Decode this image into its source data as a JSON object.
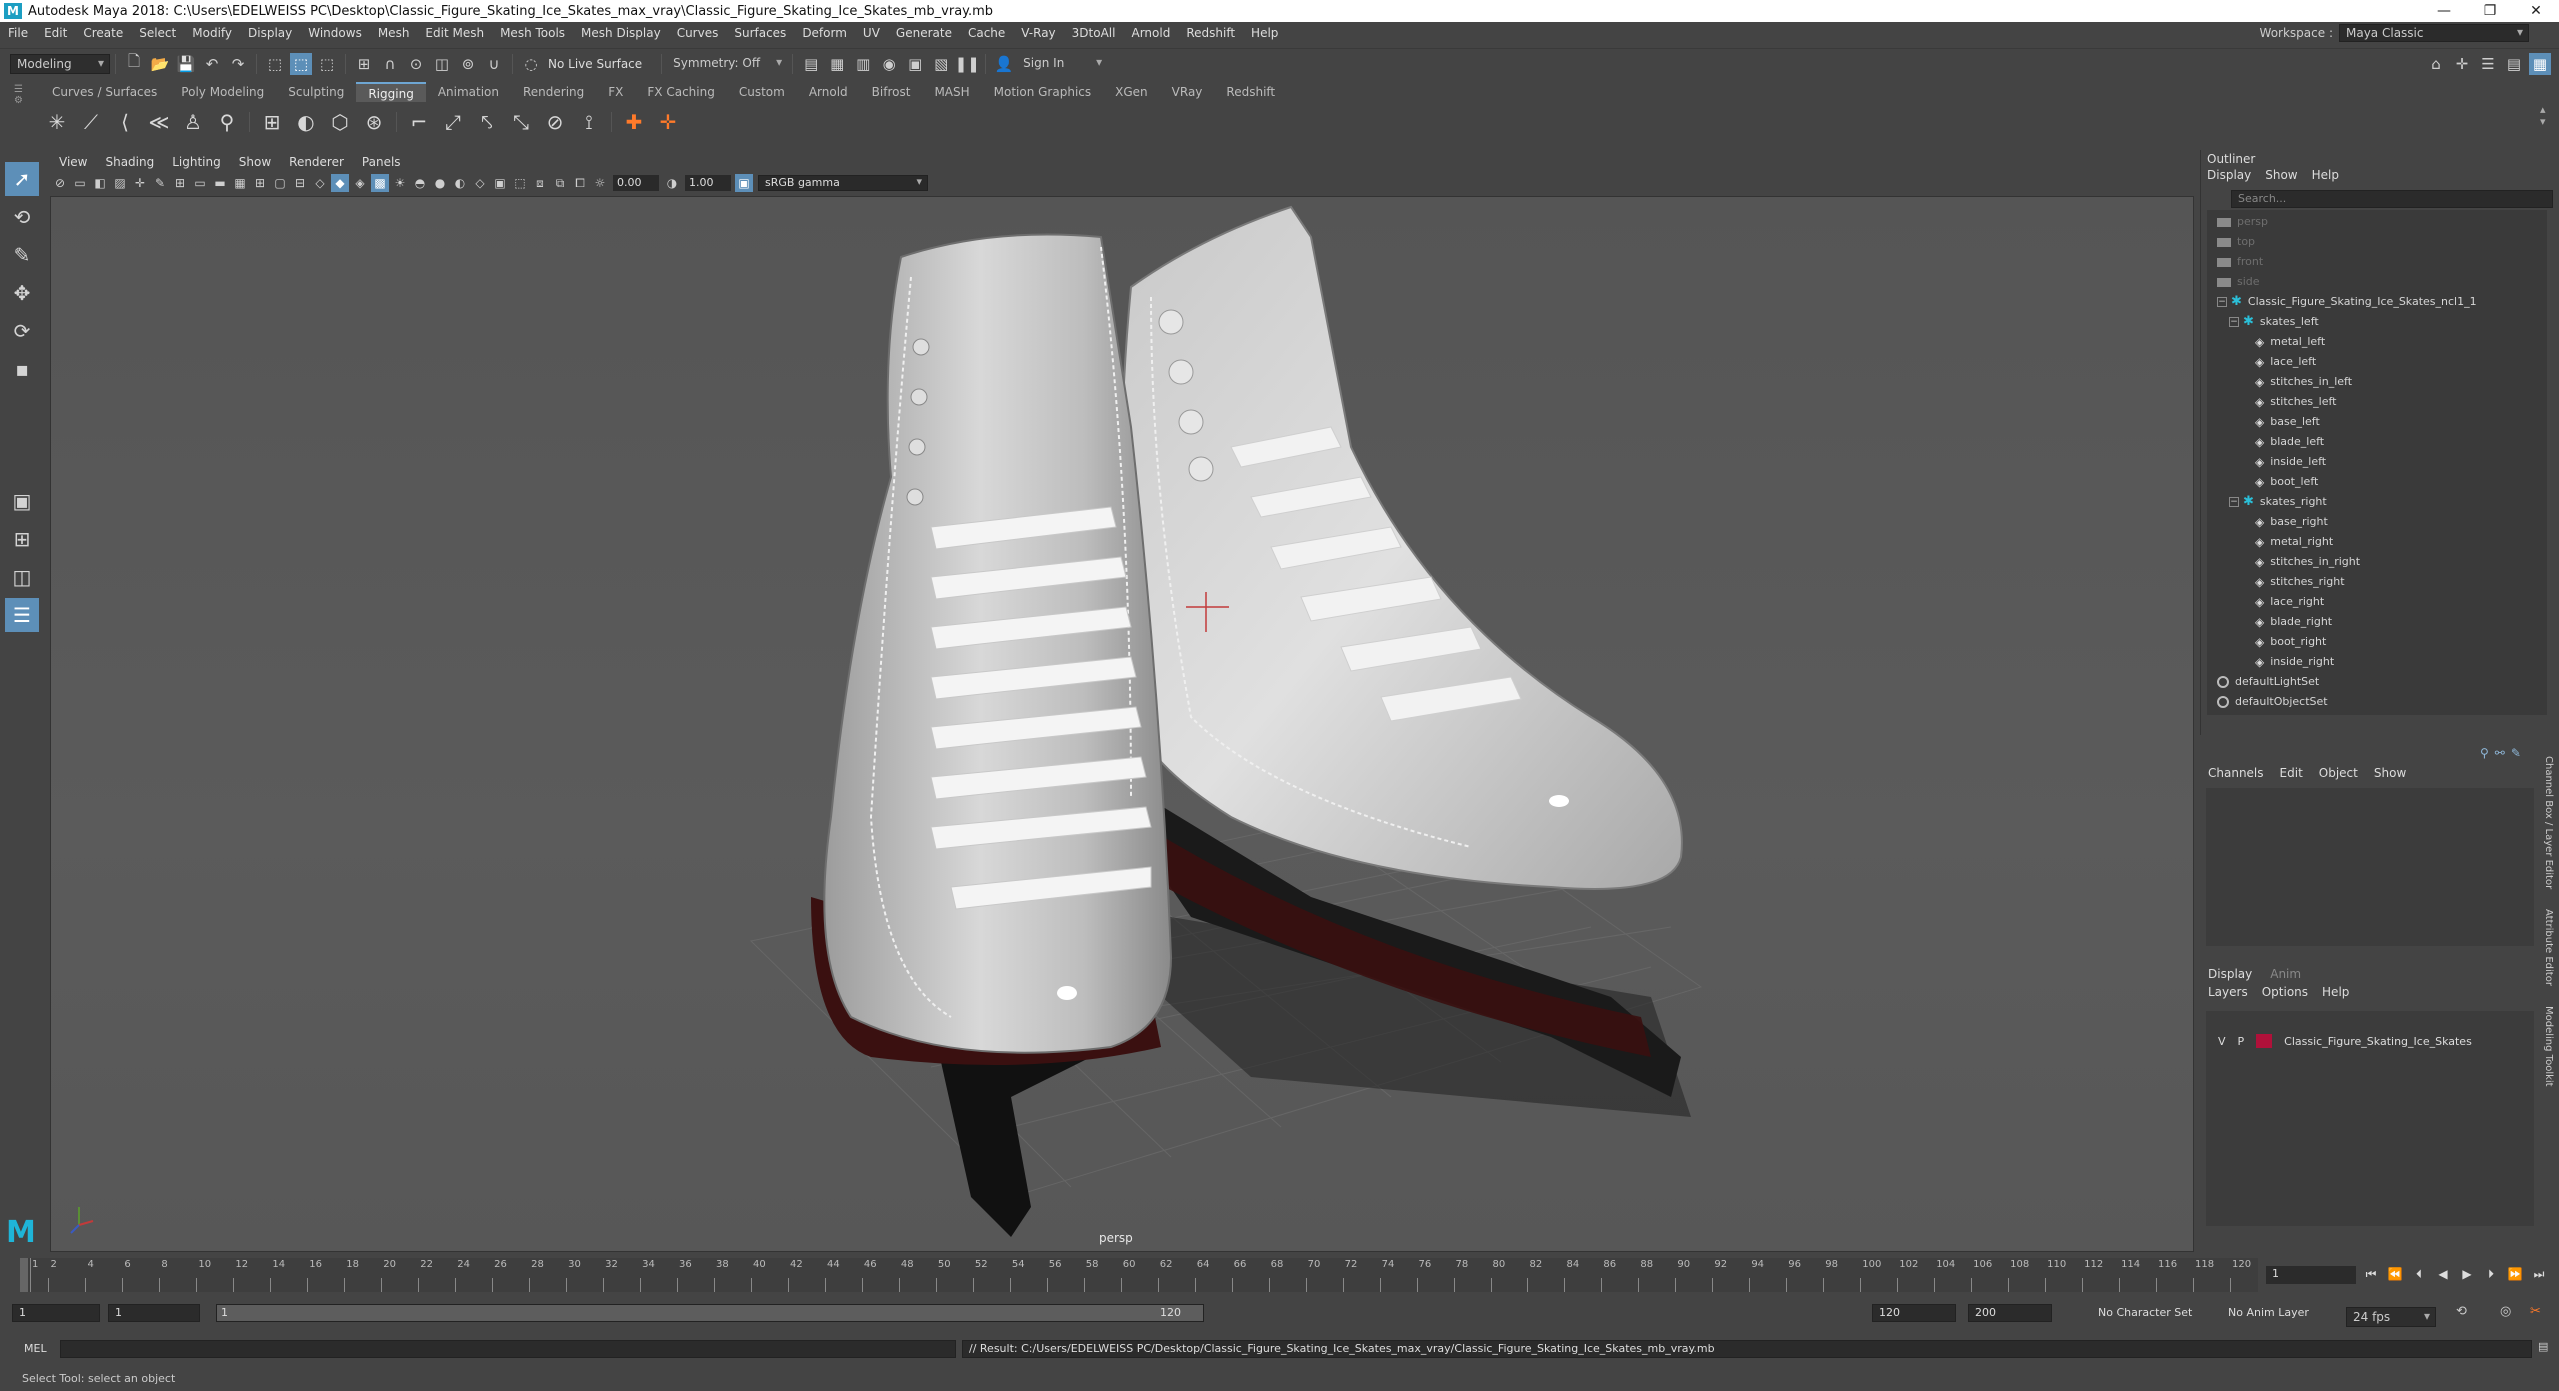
{
  "window": {
    "title": "Autodesk Maya 2018: C:\\Users\\EDELWEISS PC\\Desktop\\Classic_Figure_Skating_Ice_Skates_max_vray\\Classic_Figure_Skating_Ice_Skates_mb_vray.mb",
    "logo": "M",
    "min": "—",
    "max": "❐",
    "close": "✕"
  },
  "menubar": {
    "items": [
      "File",
      "Edit",
      "Create",
      "Select",
      "Modify",
      "Display",
      "Windows",
      "Mesh",
      "Edit Mesh",
      "Mesh Tools",
      "Mesh Display",
      "Curves",
      "Surfaces",
      "Deform",
      "UV",
      "Generate",
      "Cache",
      "V-Ray",
      "3DtoAll",
      "Arnold",
      "Redshift",
      "Help"
    ],
    "workspace_label": "Workspace :",
    "workspace_value": "Maya Classic"
  },
  "statusline": {
    "mode": "Modeling",
    "live_surface": "No Live Surface",
    "symmetry": "Symmetry: Off",
    "sign_in": "Sign In"
  },
  "shelf": {
    "tabs": [
      "Curves / Surfaces",
      "Poly Modeling",
      "Sculpting",
      "Rigging",
      "Animation",
      "Rendering",
      "FX",
      "FX Caching",
      "Custom",
      "Arnold",
      "Bifrost",
      "MASH",
      "Motion Graphics",
      "XGen",
      "VRay",
      "Redshift"
    ],
    "active_tab": "Rigging"
  },
  "viewport": {
    "menus": [
      "View",
      "Shading",
      "Lighting",
      "Show",
      "Renderer",
      "Panels"
    ],
    "exposure": "0.00",
    "gamma": "1.00",
    "colorspace": "sRGB gamma",
    "camera": "persp"
  },
  "outliner": {
    "title": "Outliner",
    "menus": [
      "Display",
      "Show",
      "Help"
    ],
    "search_placeholder": "Search...",
    "items": [
      {
        "label": "persp",
        "kind": "cam",
        "depth": 0,
        "dim": true
      },
      {
        "label": "top",
        "kind": "cam",
        "depth": 0,
        "dim": true
      },
      {
        "label": "front",
        "kind": "cam",
        "depth": 0,
        "dim": true
      },
      {
        "label": "side",
        "kind": "cam",
        "depth": 0,
        "dim": true
      },
      {
        "label": "Classic_Figure_Skating_Ice_Skates_ncl1_1",
        "kind": "grp",
        "depth": 0,
        "toggle": "−"
      },
      {
        "label": "skates_left",
        "kind": "grp",
        "depth": 1,
        "toggle": "−"
      },
      {
        "label": "metal_left",
        "kind": "mesh",
        "depth": 2
      },
      {
        "label": "lace_left",
        "kind": "mesh",
        "depth": 2
      },
      {
        "label": "stitches_in_left",
        "kind": "mesh",
        "depth": 2
      },
      {
        "label": "stitches_left",
        "kind": "mesh",
        "depth": 2
      },
      {
        "label": "base_left",
        "kind": "mesh",
        "depth": 2
      },
      {
        "label": "blade_left",
        "kind": "mesh",
        "depth": 2
      },
      {
        "label": "inside_left",
        "kind": "mesh",
        "depth": 2
      },
      {
        "label": "boot_left",
        "kind": "mesh",
        "depth": 2
      },
      {
        "label": "skates_right",
        "kind": "grp",
        "depth": 1,
        "toggle": "−"
      },
      {
        "label": "base_right",
        "kind": "mesh",
        "depth": 2
      },
      {
        "label": "metal_right",
        "kind": "mesh",
        "depth": 2
      },
      {
        "label": "stitches_in_right",
        "kind": "mesh",
        "depth": 2
      },
      {
        "label": "stitches_right",
        "kind": "mesh",
        "depth": 2
      },
      {
        "label": "lace_right",
        "kind": "mesh",
        "depth": 2
      },
      {
        "label": "blade_right",
        "kind": "mesh",
        "depth": 2
      },
      {
        "label": "boot_right",
        "kind": "mesh",
        "depth": 2
      },
      {
        "label": "inside_right",
        "kind": "mesh",
        "depth": 2
      },
      {
        "label": "defaultLightSet",
        "kind": "set",
        "depth": 0
      },
      {
        "label": "defaultObjectSet",
        "kind": "set",
        "depth": 0
      }
    ]
  },
  "channelbox": {
    "menus": [
      "Channels",
      "Edit",
      "Object",
      "Show"
    ]
  },
  "layers": {
    "tabs": [
      "Display",
      "Anim"
    ],
    "menus": [
      "Layers",
      "Options",
      "Help"
    ],
    "row": {
      "v": "V",
      "p": "P",
      "name": "Classic_Figure_Skating_Ice_Skates",
      "color": "#b0113a"
    }
  },
  "sidetabs": [
    "Channel Box / Layer Editor",
    "Attribute Editor",
    "Modeling Toolkit"
  ],
  "timeline": {
    "ticks": [
      1,
      2,
      4,
      6,
      8,
      10,
      12,
      14,
      16,
      18,
      20,
      22,
      24,
      26,
      28,
      30,
      32,
      34,
      36,
      38,
      40,
      42,
      44,
      46,
      48,
      50,
      52,
      54,
      56,
      58,
      60,
      62,
      64,
      66,
      68,
      70,
      72,
      74,
      76,
      78,
      80,
      82,
      84,
      86,
      88,
      90,
      92,
      94,
      96,
      98,
      100,
      102,
      104,
      106,
      108,
      110,
      112,
      114,
      116,
      118,
      120
    ],
    "current_frame": "1"
  },
  "range": {
    "start": "1",
    "anim_start": "1",
    "range_start_label": "1",
    "range_end_label": "120",
    "end": "120",
    "anim_end": "200",
    "character_set": "No Character Set",
    "anim_layer": "No Anim Layer",
    "fps": "24 fps"
  },
  "commandline": {
    "lang": "MEL",
    "result": "// Result: C:/Users/EDELWEISS PC/Desktop/Classic_Figure_Skating_Ice_Skates_max_vray/Classic_Figure_Skating_Ice_Skates_mb_vray.mb"
  },
  "helpline": "Select Tool: select an object"
}
